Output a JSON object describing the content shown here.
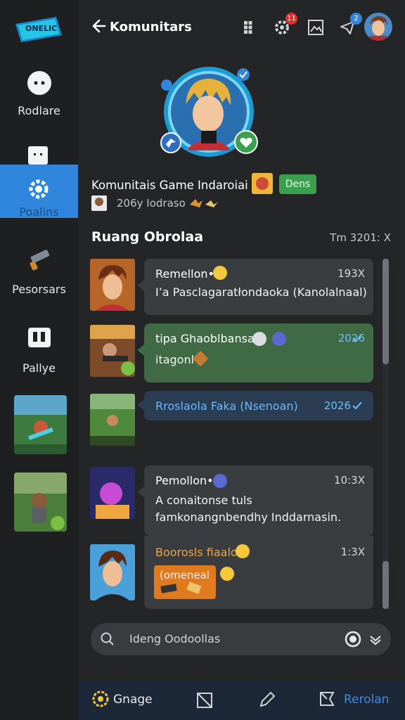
{
  "sidebar": {
    "logo_text": "ONELIC",
    "items": [
      {
        "label": "Rodlare",
        "icon": "chat-dots-icon"
      },
      {
        "label": "Poalins",
        "icon": "gear-icon",
        "active": true
      },
      {
        "label": "Pesorsars",
        "icon": "gun-icon"
      },
      {
        "label": "Pallye",
        "icon": "bracket-icon"
      }
    ]
  },
  "header": {
    "title": "Komunitars",
    "badges": {
      "notifications": "11",
      "messages": "2"
    }
  },
  "group": {
    "name": "Komunitais Game Indaroiai",
    "subtitle": "206y Iodraso",
    "button_label": "Dens"
  },
  "chat": {
    "section_title": "Ruang Obrolaa",
    "section_meta": "Tm 3201: X",
    "messages": [
      {
        "name": "Remellon•",
        "time": "193X",
        "text": "I’a Pasclagaratłondaoka (Kanolalnaal)",
        "style": "dark"
      },
      {
        "name": "tipa Ghaoblbansan",
        "time": "2026",
        "text": "itagonl",
        "style": "green"
      },
      {
        "name": "Rroslaola Faka (Nsenoan)",
        "time": "2026",
        "text": "",
        "style": "blue"
      },
      {
        "name": "Pemollon•",
        "time": "10:3X",
        "text": "A conaitonse tuls famkonangnbendhy Inddarnasin.",
        "style": "dark"
      },
      {
        "name": "Boorosls fiaalox",
        "time": "1:3X",
        "text": "(omeneal",
        "style": "dark"
      }
    ]
  },
  "search": {
    "placeholder": "Ideng Oodoollas"
  },
  "bottom_nav": {
    "items": [
      {
        "label": "Gnage"
      },
      {
        "label": ""
      },
      {
        "label": ""
      },
      {
        "label": "Rerolan"
      }
    ]
  },
  "colors": {
    "accent": "#2f86dc",
    "green": "#3aa04d",
    "orange": "#e07a1f"
  }
}
